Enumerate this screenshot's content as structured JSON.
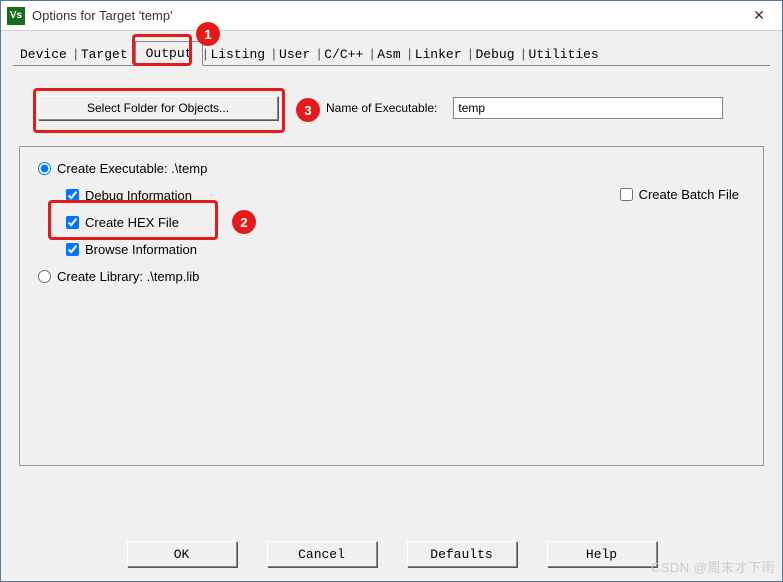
{
  "window": {
    "icon_text": "Vs",
    "title": "Options for Target 'temp'",
    "close_glyph": "✕"
  },
  "tabs": {
    "device": "Device",
    "target": "Target",
    "output": "Output",
    "listing": "Listing",
    "user": "User",
    "cpp": "C/C++",
    "asm": "Asm",
    "linker": "Linker",
    "debug": "Debug",
    "utilities": "Utilities"
  },
  "output_tab": {
    "select_folder_btn": "Select Folder for Objects...",
    "name_exec_label": "Name of Executable:",
    "name_exec_value": "temp",
    "create_executable_label": "Create Executable:  .\\temp",
    "debug_info_label": "Debug Information",
    "create_hex_label": "Create HEX File",
    "browse_info_label": "Browse Information",
    "create_library_label": "Create Library:  .\\temp.lib",
    "create_batch_label": "Create Batch File"
  },
  "buttons": {
    "ok": "OK",
    "cancel": "Cancel",
    "defaults": "Defaults",
    "help": "Help"
  },
  "annotations": {
    "b1": "1",
    "b2": "2",
    "b3": "3"
  },
  "watermark": "CSDN @周末才下雨"
}
